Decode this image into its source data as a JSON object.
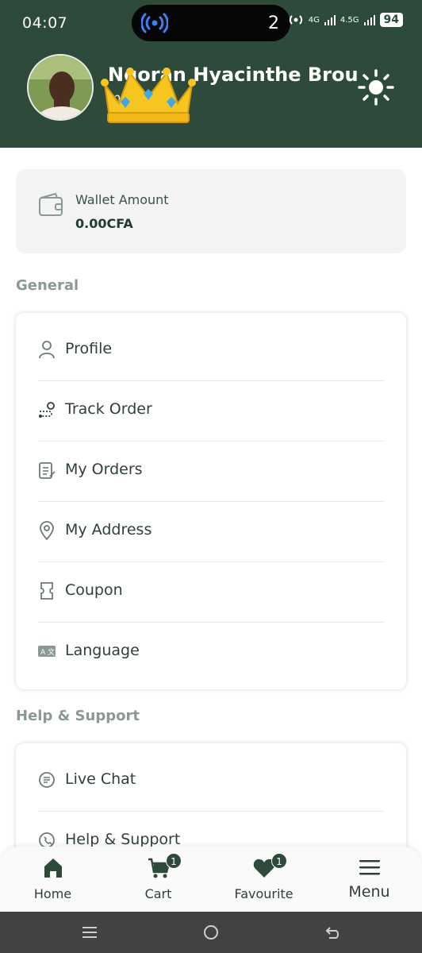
{
  "status_bar": {
    "time": "04:07",
    "island_count": "2",
    "net_4g": "4G",
    "net_45g": "4.5G",
    "battery": "94"
  },
  "header": {
    "user_name": "Ngoran Hyacinthe Brou",
    "email": "mail.com",
    "theme_toggle_icon": "sun-icon",
    "background_color": "#2d4a3a"
  },
  "wallet": {
    "label": "Wallet Amount",
    "amount": "0.00CFA"
  },
  "general": {
    "title": "General",
    "items": [
      {
        "label": "Profile",
        "icon": "user-icon"
      },
      {
        "label": "Track Order",
        "icon": "route-icon"
      },
      {
        "label": "My Orders",
        "icon": "order-list-icon"
      },
      {
        "label": "My Address",
        "icon": "location-pin-icon"
      },
      {
        "label": "Coupon",
        "icon": "coupon-icon"
      },
      {
        "label": "Language",
        "icon": "language-icon"
      }
    ]
  },
  "help": {
    "title": "Help & Support",
    "items": [
      {
        "label": "Live Chat",
        "icon": "chat-icon"
      },
      {
        "label": "Help & Support",
        "icon": "phone-icon"
      }
    ]
  },
  "bottom_nav": {
    "items": [
      {
        "label": "Home",
        "icon": "home-icon"
      },
      {
        "label": "Cart",
        "icon": "cart-icon",
        "badge": "1"
      },
      {
        "label": "Favourite",
        "icon": "heart-icon",
        "badge": "1"
      },
      {
        "label": "Menu",
        "icon": "hamburger-icon"
      }
    ]
  },
  "accent_color": "#2d4a3a"
}
